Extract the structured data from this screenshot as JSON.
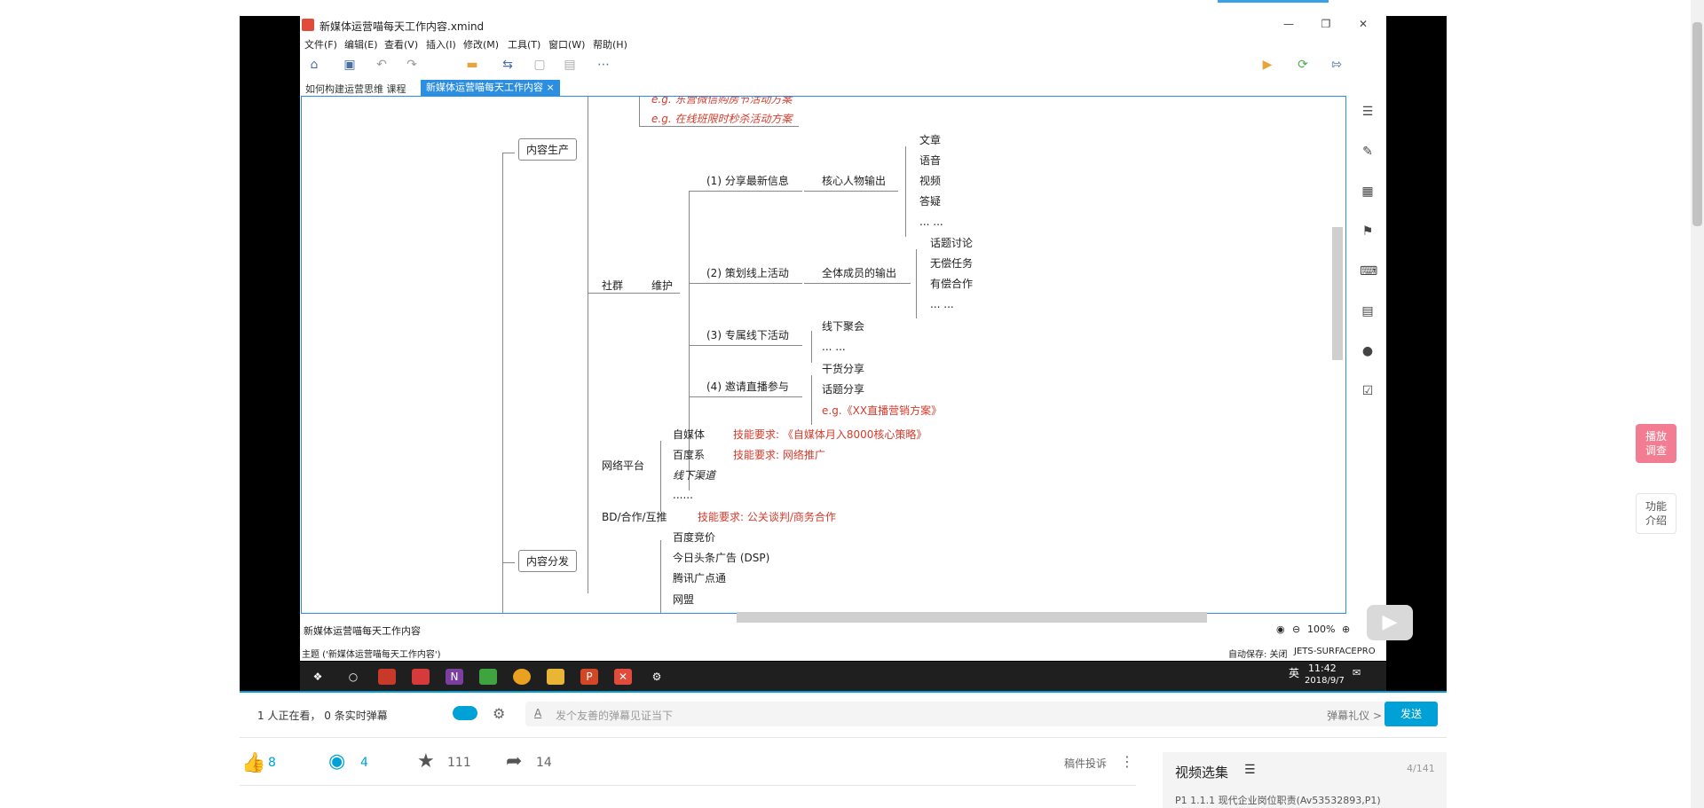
{
  "xmind": {
    "window_title": "新媒体运营喵每天工作内容.xmind",
    "menu": [
      "文件(F)",
      "编辑(E)",
      "查看(V)",
      "插入(I)",
      "修改(M)",
      "工具(T)",
      "窗口(W)",
      "帮助(H)"
    ],
    "tabs": [
      "如何构建运营思维 课程",
      "新媒体运营喵每天工作内容"
    ],
    "tab_close": "×",
    "statusbar_topic": "新媒体运营喵每天工作内容",
    "zoom": "100%",
    "status_line": "主题 ('新媒体运营喵每天工作内容')",
    "autosave": "自动保存: 关闭",
    "device": "JETS-SURFACEPRO"
  },
  "mindmap": {
    "top_red_1": "e.g. 东营微信购房节活动方案",
    "top_red_2": "e.g. 在线班限时秒杀活动方案",
    "content_production": "内容生产",
    "community": "社群",
    "maintain": "维护",
    "item1": "(1) 分享最新信息",
    "item1_child": "核心人物输出",
    "item1_leaves": [
      "文章",
      "语音",
      "视频",
      "答疑",
      "... ..."
    ],
    "item2": "(2) 策划线上活动",
    "item2_child": "全体成员的输出",
    "item2_leaves": [
      "话题讨论",
      "无偿任务",
      "有偿合作",
      "... ..."
    ],
    "item3": "(3) 专属线下活动",
    "item3_leaves": [
      "线下聚会",
      "... ..."
    ],
    "item4": "(4) 邀请直播参与",
    "item4_leaves": [
      "干货分享",
      "话题分享"
    ],
    "item4_red": "e.g.《XX直播营销方案》",
    "network": "网络平台",
    "self_media": "自媒体",
    "self_media_req": "技能要求: 《自媒体月入8000核心策略》",
    "baidu_series": "百度系",
    "baidu_req": "技能要求: 网络推广",
    "offline": "线下渠道",
    "dots": "......",
    "bd": "BD/合作/互推",
    "bd_req": "技能要求: 公关谈判/商务合作",
    "content_dist": "内容分发",
    "ads": [
      "百度竞价",
      "今日头条广告 (DSP)",
      "腾讯广点通",
      "网盟"
    ]
  },
  "taskbar": {
    "time": "11:42",
    "date": "2018/9/7",
    "ime": "英"
  },
  "bili": {
    "watching": "1 人正在看， 0 条实时弹幕",
    "danmu_placeholder": "发个友善的弹幕见证当下",
    "danmu_etiquette": "弹幕礼仪 >",
    "send": "发送",
    "likes": "8",
    "coins": "4",
    "favorites": "111",
    "shares": "14",
    "report": "稿件投诉",
    "playlist_title": "视频选集",
    "playlist_count": "4/141",
    "playlist_item": "P1  1.1.1 现代企业岗位职责(Av53532893,P1)",
    "float_1": "播放\n调查",
    "float_2": "功能\n介绍"
  },
  "colors": {
    "accent": "#00a1d6",
    "xmind_blue": "#2c8ee0",
    "red_text": "#d43b2c"
  }
}
